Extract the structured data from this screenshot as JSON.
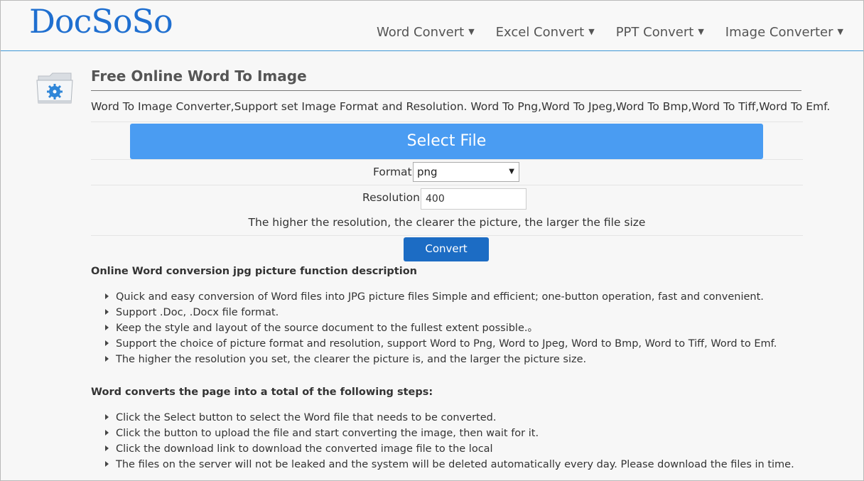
{
  "header": {
    "logo": "DocSoSo",
    "nav": [
      {
        "label": "Word Convert"
      },
      {
        "label": "Excel Convert"
      },
      {
        "label": "PPT Convert"
      },
      {
        "label": "Image Converter"
      }
    ]
  },
  "main": {
    "title": "Free Online Word To Image",
    "subtitle": "Word To Image Converter,Support set Image Format and Resolution. Word To Png,Word To Jpeg,Word To Bmp,Word To Tiff,Word To Emf.",
    "select_file_label": "Select File",
    "format_label": "Format",
    "format_value": "png",
    "resolution_label": "Resolution",
    "resolution_value": "400",
    "hint": "The higher the resolution, the clearer the picture, the larger the file size",
    "convert_label": "Convert"
  },
  "description": {
    "heading": "Online Word conversion jpg picture function description",
    "items": [
      "Quick and easy conversion of Word files into JPG picture files Simple and efficient; one-button operation, fast and convenient.",
      "Support .Doc, .Docx file format.",
      "Keep the style and layout of the source document to the fullest extent possible.。",
      "Support the choice of picture format and resolution, support Word to Png, Word to Jpeg, Word to Bmp, Word to Tiff, Word to Emf.",
      "The higher the resolution you set, the clearer the picture is, and the larger the picture size."
    ]
  },
  "steps": {
    "heading": "Word converts the page into a total of the following steps:",
    "items": [
      "Click the Select button to select the Word file that needs to be converted.",
      "Click the button to upload the file and start converting the image, then wait for it.",
      "Click the download link to download the converted image file to the local",
      "The files on the server will not be leaked and the system will be deleted automatically every day. Please download the files in time."
    ]
  }
}
